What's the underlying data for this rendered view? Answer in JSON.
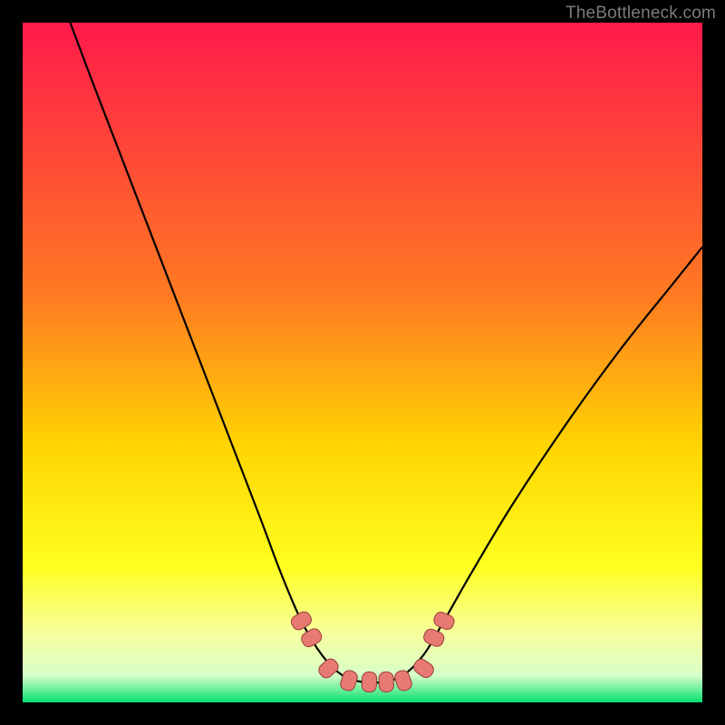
{
  "watermark": "TheBottleneck.com",
  "colors": {
    "frame": "#000000",
    "grad_top": "#ff1a4b",
    "grad_b1": "#ff7a22",
    "grad_b2": "#ffd400",
    "grad_b3": "#ffff20",
    "grad_b4": "#f6ffa0",
    "grad_b5": "#d8ffc8",
    "grad_bottom": "#06e070",
    "curve": "#000000",
    "nodes_fill": "#e87a74",
    "nodes_stroke": "#9b3e38"
  },
  "chart_data": {
    "type": "line",
    "title": "",
    "xlabel": "",
    "ylabel": "",
    "xlim": [
      0,
      100
    ],
    "ylim": [
      0,
      100
    ],
    "series": [
      {
        "name": "bottleneck-curve",
        "x": [
          7,
          10,
          15,
          20,
          25,
          30,
          35,
          38,
          41,
          44,
          47,
          50,
          53,
          56,
          59,
          62,
          66,
          72,
          80,
          88,
          96,
          100
        ],
        "y": [
          100,
          92,
          79,
          66,
          53,
          40,
          27,
          19,
          12,
          7,
          4,
          3,
          3,
          4,
          7,
          12,
          19,
          29,
          41,
          52,
          62,
          67
        ]
      }
    ],
    "nodes": {
      "name": "highlight-nodes",
      "x": [
        41,
        42.5,
        45,
        48,
        51,
        53.5,
        56,
        59,
        60.5,
        62
      ],
      "y": [
        12,
        9.5,
        5,
        3.2,
        3,
        3,
        3.2,
        5,
        9.5,
        12
      ]
    }
  }
}
